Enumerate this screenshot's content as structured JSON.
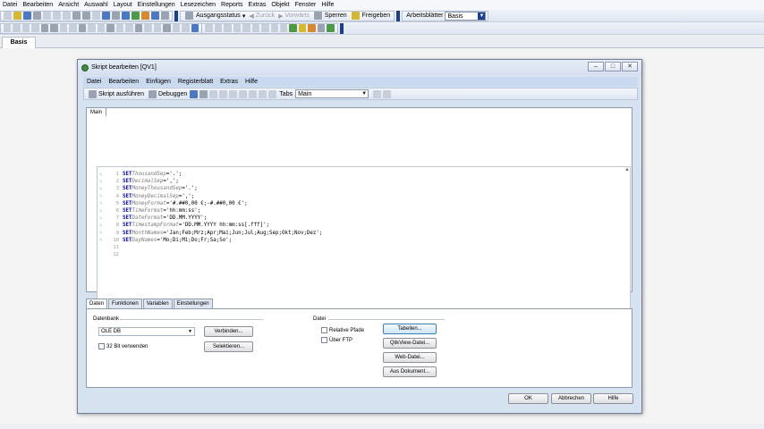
{
  "app_menu": [
    "Datei",
    "Bearbeiten",
    "Ansicht",
    "Auswahl",
    "Layout",
    "Einstellungen",
    "Lesezeichen",
    "Reports",
    "Extras",
    "Objekt",
    "Fenster",
    "Hilfe"
  ],
  "toolbar": {
    "ausgangsstatus": "Ausgangsstatus",
    "zurueck": "Zurück",
    "vorwaerts": "Vorwärts",
    "sperren": "Sperren",
    "freigeben": "Freigeben",
    "arbeitsblaetter_label": "Arbeitsblätter",
    "sheet_value": "Basis"
  },
  "sheet_tab": "Basis",
  "dialog": {
    "title": "Skript bearbeiten [QV1]",
    "window_buttons": [
      "–",
      "□",
      "✕"
    ],
    "menu": [
      "Datei",
      "Bearbeiten",
      "Einfügen",
      "Registerblatt",
      "Extras",
      "Hilfe"
    ],
    "toolbar": {
      "run": "Skript ausführen",
      "debug": "Debuggen",
      "tabs_label": "Tabs",
      "tabs_value": "Main"
    },
    "editor_tab": "Main",
    "lines": [
      {
        "n": "1",
        "kw": "SET",
        "var": "ThousandSep",
        "val": "='.';"
      },
      {
        "n": "2",
        "kw": "SET",
        "var": "DecimalSep",
        "val": "=',';"
      },
      {
        "n": "3",
        "kw": "SET",
        "var": "MoneyThousandSep",
        "val": "='.';"
      },
      {
        "n": "4",
        "kw": "SET",
        "var": "MoneyDecimalSep",
        "val": "=',';"
      },
      {
        "n": "5",
        "kw": "SET",
        "var": "MoneyFormat",
        "val": "='#.##0,00 €;-#.##0,00 €';"
      },
      {
        "n": "6",
        "kw": "SET",
        "var": "TimeFormat",
        "val": "='hh:mm:ss';"
      },
      {
        "n": "7",
        "kw": "SET",
        "var": "DateFormat",
        "val": "='DD.MM.YYYY';"
      },
      {
        "n": "8",
        "kw": "SET",
        "var": "TimestampFormat",
        "val": "='DD.MM.YYYY hh:mm:ss[.fff]';"
      },
      {
        "n": "9",
        "kw": "SET",
        "var": "MonthNames",
        "val": "='Jan;Feb;Mrz;Apr;Mai;Jun;Jul;Aug;Sep;Okt;Nov;Dez';"
      },
      {
        "n": "10",
        "kw": "SET",
        "var": "DayNames",
        "val": "='Mo;Di;Mi;Do;Fr;Sa;So';"
      },
      {
        "n": "11",
        "kw": "",
        "var": "",
        "val": ""
      },
      {
        "n": "12",
        "kw": "",
        "var": "",
        "val": ""
      }
    ],
    "panel_tabs": [
      "Daten",
      "Funktionen",
      "Variablen",
      "Einstellungen"
    ],
    "panel": {
      "datenbank_label": "Datenbank",
      "db_value": "OLE DB",
      "bit32_label": "32 Bit verwenden",
      "verbinden": "Verbinden...",
      "selektieren": "Selektieren...",
      "datei_label": "Datei",
      "relative_pfade": "Relative Pfade",
      "ueber_ftp": "Über FTP",
      "tabellen": "Tabellen...",
      "qlikview_datei": "QlikView-Datei...",
      "web_datei": "Web-Datei...",
      "aus_dokument": "Aus Dokument..."
    },
    "footer": {
      "ok": "OK",
      "abbrechen": "Abbrechen",
      "hilfe": "Hilfe"
    }
  }
}
